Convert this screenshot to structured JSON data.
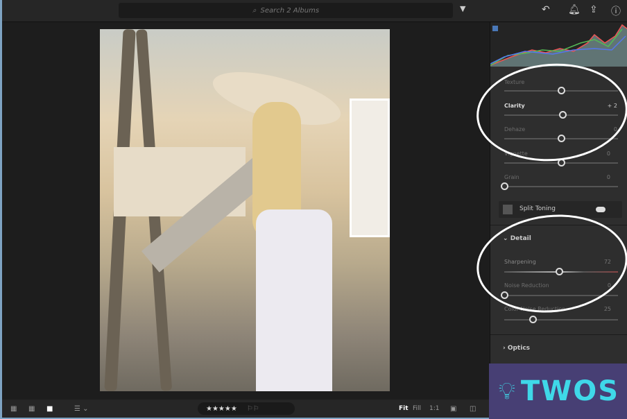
{
  "topbar": {
    "search_placeholder": "Search 2 Albums"
  },
  "panel": {
    "sliders_top": [
      {
        "label": "Texture",
        "value": "",
        "position": 0.5
      },
      {
        "label": "Clarity",
        "value": "+ 2",
        "position": 0.51
      },
      {
        "label": "Dehaze",
        "value": "0",
        "position": 0.5
      },
      {
        "label": "Vignette",
        "value": "0",
        "position": 0.5
      },
      {
        "label": "Grain",
        "value": "0",
        "position": 0.0
      }
    ],
    "split_toning": {
      "label": "Split Toning",
      "enabled": true
    },
    "detail": {
      "label": "Detail",
      "sliders": [
        {
          "label": "Sharpening",
          "value": "72",
          "position": 0.48
        },
        {
          "label": "Noise Reduction",
          "value": "0",
          "position": 0.0
        },
        {
          "label": "Color Noise Reduction",
          "value": "25",
          "position": 0.25
        }
      ]
    },
    "optics": {
      "label": "Optics"
    }
  },
  "bottombar": {
    "stars": "★★★★★",
    "fit": "Fit",
    "fill": "Fill",
    "one_to_one": "1:1"
  },
  "logo": {
    "text": "TWOS"
  },
  "colors": {
    "accent": "#3fd8e8",
    "logo_bg": "#473f74"
  }
}
